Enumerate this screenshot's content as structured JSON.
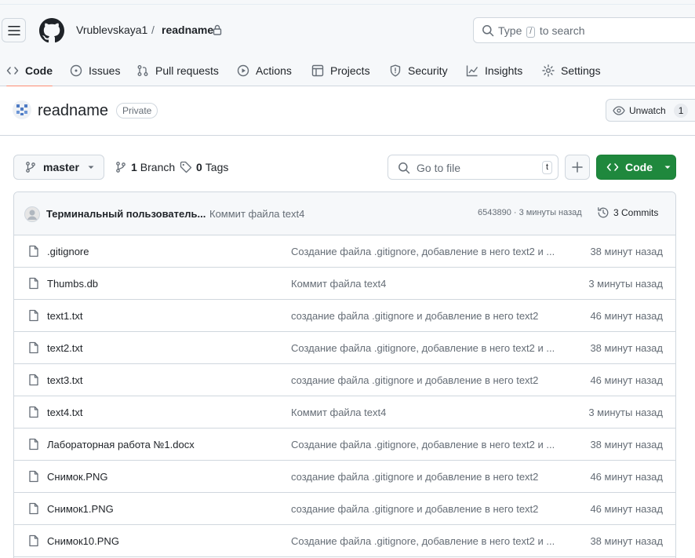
{
  "header": {
    "owner": "Vrublevskaya1",
    "separator": "/",
    "repo": "readname",
    "search_prefix": "Type",
    "search_key": "/",
    "search_suffix": "to search"
  },
  "nav": {
    "tabs": [
      {
        "label": "Code",
        "icon": "code-icon"
      },
      {
        "label": "Issues",
        "icon": "issue-icon"
      },
      {
        "label": "Pull requests",
        "icon": "pull-request-icon"
      },
      {
        "label": "Actions",
        "icon": "play-icon"
      },
      {
        "label": "Projects",
        "icon": "table-icon"
      },
      {
        "label": "Security",
        "icon": "shield-icon"
      },
      {
        "label": "Insights",
        "icon": "graph-icon"
      },
      {
        "label": "Settings",
        "icon": "gear-icon"
      }
    ]
  },
  "repo": {
    "name": "readname",
    "visibility": "Private",
    "unwatch_label": "Unwatch",
    "watch_count": "1"
  },
  "toolbar": {
    "branch": "master",
    "branch_count": "1",
    "branch_label": "Branch",
    "tag_count": "0",
    "tag_label": "Tags",
    "goto_placeholder": "Go to file",
    "goto_key": "t",
    "code_label": "Code"
  },
  "commit": {
    "author": "Терминальный пользователь...",
    "message": "Коммит файла text4",
    "meta": "6543890 · 3 минуты назад",
    "commits_label": "3 Commits"
  },
  "files": [
    {
      "name": ".gitignore",
      "message": "Создание файла .gitignore, добавление в него text2 и ...",
      "time": "38 минут назад"
    },
    {
      "name": "Thumbs.db",
      "message": "Коммит файла text4",
      "time": "3 минуты назад"
    },
    {
      "name": "text1.txt",
      "message": "создание файла .gitignore и добавление в него text2",
      "time": "46 минут назад"
    },
    {
      "name": "text2.txt",
      "message": "Создание файла .gitignore, добавление в него text2 и ...",
      "time": "38 минут назад"
    },
    {
      "name": "text3.txt",
      "message": "создание файла .gitignore и добавление в него text2",
      "time": "46 минут назад"
    },
    {
      "name": "text4.txt",
      "message": "Коммит файла text4",
      "time": "3 минуты назад"
    },
    {
      "name": "Лабораторная работа №1.docx",
      "message": "Создание файла .gitignore, добавление в него text2 и ...",
      "time": "38 минут назад"
    },
    {
      "name": "Снимок.PNG",
      "message": "создание файла .gitignore и добавление в него text2",
      "time": "46 минут назад"
    },
    {
      "name": "Снимок1.PNG",
      "message": "создание файла .gitignore и добавление в него text2",
      "time": "46 минут назад"
    },
    {
      "name": "Снимок10.PNG",
      "message": "Создание файла .gitignore, добавление в него text2 и ...",
      "time": "38 минут назад"
    }
  ],
  "colors": {
    "accent_green": "#1f883d",
    "tab_underline": "#fd8c73",
    "border": "#d0d7de"
  }
}
